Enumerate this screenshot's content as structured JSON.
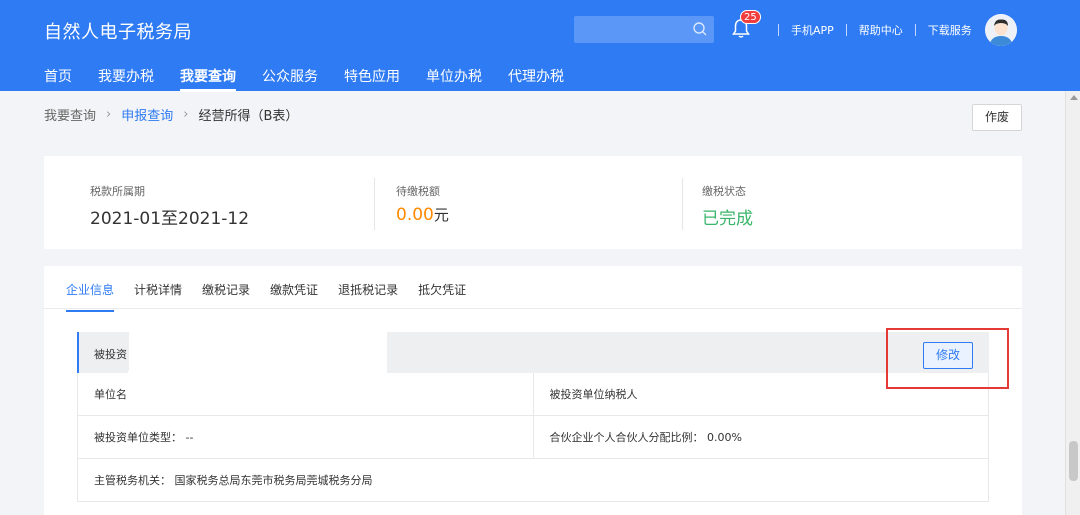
{
  "header": {
    "brand": "自然人电子税务局",
    "search_placeholder": "",
    "notification_count": "25",
    "links": [
      "手机APP",
      "帮助中心",
      "下载服务"
    ],
    "nav": [
      "首页",
      "我要办税",
      "我要查询",
      "公众服务",
      "特色应用",
      "单位办税",
      "代理办税"
    ],
    "active_nav": "我要查询"
  },
  "breadcrumb": {
    "root": "我要查询",
    "parent": "申报查询",
    "current": "经营所得（B表）"
  },
  "toolbar": {
    "void_label": "作废"
  },
  "summary": {
    "period_label": "税款所属期",
    "period_value": "2021-01至2021-12",
    "due_label": "待缴税额",
    "due_value": "0.00",
    "due_unit": "元",
    "status_label": "缴税状态",
    "status_value": "已完成"
  },
  "tabs": [
    "企业信息",
    "计税详情",
    "缴税记录",
    "缴款凭证",
    "退抵税记录",
    "抵欠凭证"
  ],
  "active_tab": "企业信息",
  "section": {
    "title": "被投资",
    "edit_label": "修改"
  },
  "rows": [
    [
      "单位名",
      "被投资单位纳税人"
    ],
    [
      "被投资单位类型： --",
      "合伙企业个人合伙人分配比例： 0.00%"
    ],
    [
      "主管税务机关： 国家税务总局东莞市税务局莞城税务分局"
    ]
  ],
  "colors": {
    "brand_blue": "#2f7bf3",
    "amount_orange": "#ff8a00",
    "status_green": "#3ab66a",
    "highlight_red": "#e53935"
  }
}
